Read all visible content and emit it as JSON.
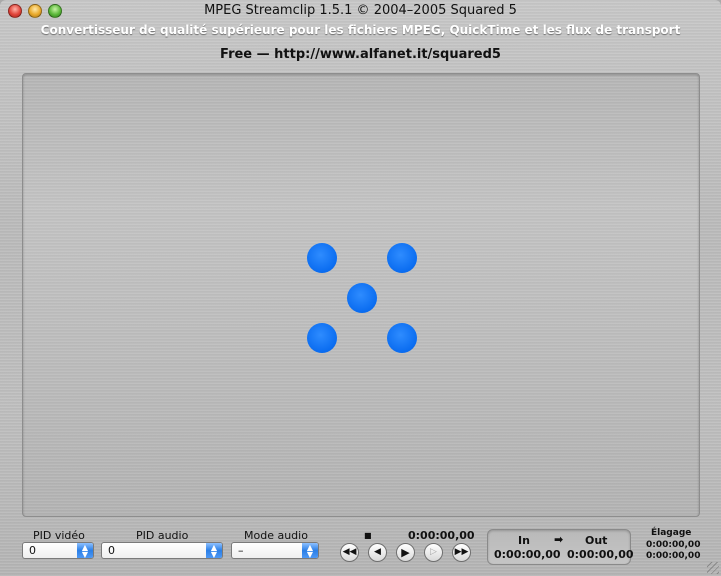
{
  "window": {
    "title": "MPEG Streamclip 1.5.1  ©  2004–2005 Squared 5",
    "subtitle": "Convertisseur de qualité supérieure pour les fichiers MPEG, QuickTime et les flux de transport",
    "free_text": "Free  —  http://www.alfanet.it/squared5"
  },
  "viewer": {
    "logo": "five-blue-dots",
    "dot_color": "#0a6cf0"
  },
  "controls": {
    "pid_video": {
      "label": "PID vidéo",
      "value": "0"
    },
    "pid_audio": {
      "label": "PID audio",
      "value": "0"
    },
    "audio_mode": {
      "label": "Mode audio",
      "value": "–"
    },
    "stop_marker": "■",
    "current_time": "0:00:00,00",
    "transport": {
      "rewind": "◀◀",
      "step_back": "◀",
      "play": "▶",
      "step_forward": "▷",
      "fast_forward": "▶▶"
    },
    "in_out": {
      "in_label": "In",
      "arrow": "➡",
      "out_label": "Out",
      "in_time": "0:00:00,00",
      "out_time": "0:00:00,00"
    },
    "trim": {
      "label": "Élagage",
      "time1": "0:00:00,00",
      "time2": "0:00:00,00"
    }
  }
}
